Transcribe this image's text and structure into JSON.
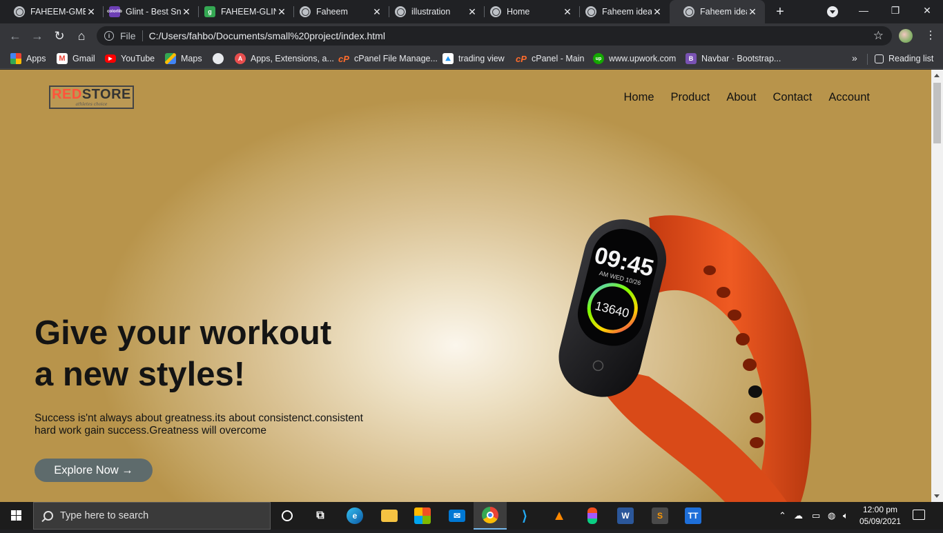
{
  "browser": {
    "tabs": [
      {
        "title": "FAHEEM-GME",
        "favicon": "globe-icon"
      },
      {
        "title": "Glint - Best Sn",
        "favicon": "colorlib-icon"
      },
      {
        "title": "FAHEEM-GLIN",
        "favicon": "green-g-icon"
      },
      {
        "title": "Faheem",
        "favicon": "globe-icon"
      },
      {
        "title": "illustration",
        "favicon": "globe-icon"
      },
      {
        "title": "Home",
        "favicon": "globe-icon"
      },
      {
        "title": "Faheem idea",
        "favicon": "globe-icon"
      },
      {
        "title": "Faheem idea",
        "favicon": "globe-icon",
        "active": true
      }
    ],
    "address": {
      "scheme_label": "File",
      "url": "C:/Users/fahbo/Documents/small%20project/index.html"
    },
    "bookmarks": [
      {
        "label": "Apps",
        "icon": "apps-grid-icon"
      },
      {
        "label": "Gmail",
        "icon": "gmail-icon"
      },
      {
        "label": "YouTube",
        "icon": "youtube-icon"
      },
      {
        "label": "Maps",
        "icon": "maps-icon"
      },
      {
        "label": "",
        "icon": "globe-icon"
      },
      {
        "label": "Apps, Extensions, a...",
        "icon": "apps-extensions-icon"
      },
      {
        "label": "cPanel File Manage...",
        "icon": "cpanel-icon"
      },
      {
        "label": "trading view",
        "icon": "tradingview-icon"
      },
      {
        "label": "cPanel - Main",
        "icon": "cpanel-icon"
      },
      {
        "label": "www.upwork.com",
        "icon": "upwork-icon"
      },
      {
        "label": "Navbar · Bootstrap...",
        "icon": "bootstrap-icon"
      }
    ],
    "reading_list_label": "Reading list"
  },
  "page": {
    "logo": {
      "red": "RED",
      "dark": "STORE",
      "tagline": "athletes choice"
    },
    "nav": [
      "Home",
      "Product",
      "About",
      "Contact",
      "Account"
    ],
    "hero": {
      "title_line1": "Give your workout",
      "title_line2": "a new styles!",
      "text_line1": "Success is'nt always about greatness.its about consistenct.consistent",
      "text_line2": "hard work gain success.Greatness will overcome",
      "cta_label": "Explore Now →"
    },
    "product": {
      "time": "09:45",
      "date": "AM WED 10/26",
      "steps": "13640",
      "band_color": "#e8531e"
    },
    "colors": {
      "accent": "#ff523b",
      "button": "#5e6b6c"
    }
  },
  "taskbar": {
    "search_placeholder": "Type here to search",
    "time": "12:00 pm",
    "date": "05/09/2021"
  }
}
